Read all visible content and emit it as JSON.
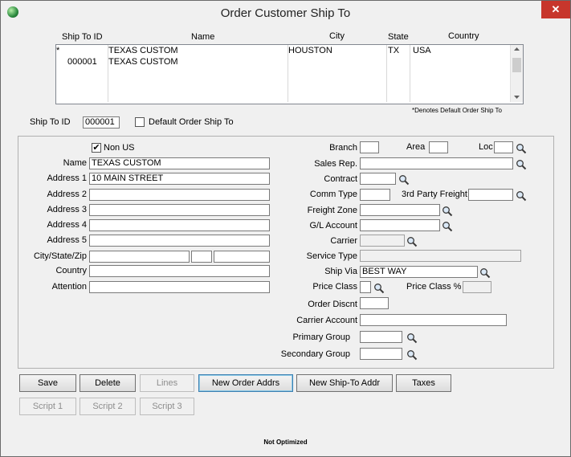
{
  "window": {
    "title": "Order Customer Ship To",
    "close_glyph": "✕"
  },
  "list": {
    "headers": [
      "Ship To ID",
      "Name",
      "City",
      "State",
      "Country"
    ],
    "rows": [
      {
        "id": "*",
        "name": "TEXAS CUSTOM",
        "city": "HOUSTON",
        "state": "TX",
        "country": "USA"
      },
      {
        "id": "000001",
        "name": "TEXAS CUSTOM",
        "city": "",
        "state": "",
        "country": ""
      }
    ],
    "footnote": "*Denotes Default Order Ship To"
  },
  "shipto": {
    "label": "Ship To ID",
    "value": "000001",
    "default_label": "Default Order Ship To",
    "default_checked": false
  },
  "left": {
    "non_us_label": "Non US",
    "non_us_checked": true,
    "name_label": "Name",
    "name": "TEXAS CUSTOM",
    "address1_label": "Address 1",
    "address1": "10 MAIN STREET",
    "address2_label": "Address 2",
    "address2": "",
    "address3_label": "Address 3",
    "address3": "",
    "address4_label": "Address 4",
    "address4": "",
    "address5_label": "Address 5",
    "address5": "",
    "csz_label": "City/State/Zip",
    "city": "",
    "state": "",
    "zip": "",
    "country_label": "Country",
    "country": "",
    "attention_label": "Attention",
    "attention": ""
  },
  "right": {
    "branch_label": "Branch",
    "branch": "",
    "area_label": "Area",
    "area": "",
    "loc_label": "Loc",
    "loc": "",
    "salesrep_label": "Sales Rep.",
    "salesrep": "",
    "contract_label": "Contract",
    "contract": "",
    "commtype_label": "Comm Type",
    "commtype": "",
    "thirdparty_label": "3rd Party Freight",
    "thirdparty": "",
    "freightzone_label": "Freight Zone",
    "freightzone": "",
    "glaccount_label": "G/L Account",
    "glaccount": "",
    "carrier_label": "Carrier",
    "carrier": "",
    "servicetype_label": "Service Type",
    "servicetype": "",
    "shipvia_label": "Ship Via",
    "shipvia": "BEST WAY",
    "priceclass_label": "Price Class",
    "priceclass": "",
    "priceclasspct_label": "Price Class %",
    "priceclasspct": "",
    "orderdiscnt_label": "Order Discnt",
    "orderdiscnt": "",
    "carrieracct_label": "Carrier Account",
    "carrieracct": "",
    "primarygroup_label": "Primary Group",
    "primarygroup": "",
    "secondarygroup_label": "Secondary Group",
    "secondarygroup": ""
  },
  "buttons": {
    "save": "Save",
    "delete": "Delete",
    "lines": "Lines",
    "new_order_addrs": "New Order Addrs",
    "new_shipto_addr": "New Ship-To Addr",
    "taxes": "Taxes",
    "script1": "Script 1",
    "script2": "Script 2",
    "script3": "Script 3"
  },
  "status": "Not Optimized",
  "icons": {
    "lookup": "magnifier-icon",
    "app": "globe-icon"
  }
}
